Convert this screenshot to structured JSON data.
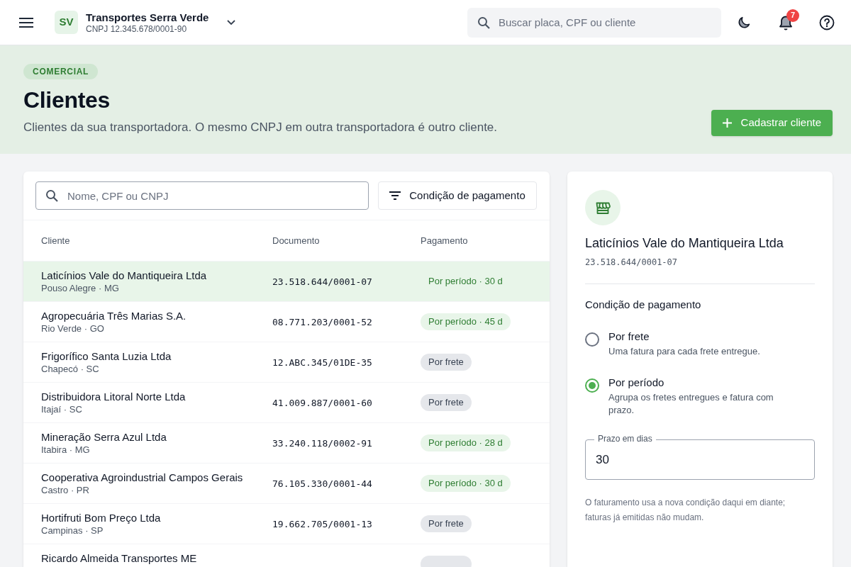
{
  "top_bar": {
    "company": {
      "initials": "SV",
      "name": "Transportes Serra Verde",
      "document": "CNPJ 12.345.678/0001-90"
    },
    "search": {
      "placeholder": "Buscar placa, CPF ou cliente"
    },
    "notifications": {
      "count": "7"
    }
  },
  "header": {
    "badge": "COMERCIAL",
    "title": "Clientes",
    "subtitle": "Clientes da sua transportadora. O mesmo CNPJ em outra transportadora é outro cliente.",
    "action": "Cadastrar cliente"
  },
  "clients": {
    "search": {
      "placeholder": "Nome, CPF ou CNPJ"
    },
    "filter": "Condição de pagamento",
    "table": {
      "columns": [
        "Cliente",
        "Documento",
        "Pagamento"
      ],
      "rows": [
        {
          "name": "Laticínios Vale do Mantiqueira Ltda",
          "location": "Pouso Alegre · MG",
          "document": "23.518.644/0001-07",
          "payment": {
            "kind": "periodo",
            "label": "Por período · 30 d"
          },
          "selected": true
        },
        {
          "name": "Agropecuária Três Marias S.A.",
          "location": "Rio Verde · GO",
          "document": "08.771.203/0001-52",
          "payment": {
            "kind": "periodo",
            "label": "Por período · 45 d"
          },
          "selected": false
        },
        {
          "name": "Frigorífico Santa Luzia Ltda",
          "location": "Chapecó · SC",
          "document": "12.ABC.345/01DE-35",
          "payment": {
            "kind": "frete",
            "label": "Por frete"
          },
          "selected": false
        },
        {
          "name": "Distribuidora Litoral Norte Ltda",
          "location": "Itajaí · SC",
          "document": "41.009.887/0001-60",
          "payment": {
            "kind": "frete",
            "label": "Por frete"
          },
          "selected": false
        },
        {
          "name": "Mineração Serra Azul Ltda",
          "location": "Itabira · MG",
          "document": "33.240.118/0002-91",
          "payment": {
            "kind": "periodo",
            "label": "Por período · 28 d"
          },
          "selected": false
        },
        {
          "name": "Cooperativa Agroindustrial Campos Gerais",
          "location": "Castro · PR",
          "document": "76.105.330/0001-44",
          "payment": {
            "kind": "periodo",
            "label": "Por período · 30 d"
          },
          "selected": false
        },
        {
          "name": "Hortifruti Bom Preço Ltda",
          "location": "Campinas · SP",
          "document": "19.662.705/0001-13",
          "payment": {
            "kind": "frete",
            "label": "Por frete"
          },
          "selected": false
        },
        {
          "name": "Ricardo Almeida Transportes ME",
          "payment": {
            "kind": "frete"
          },
          "selected": false
        }
      ]
    }
  },
  "detail": {
    "name": "Laticínios Vale do Mantiqueira Ltda",
    "document": "23.518.644/0001-07",
    "payment_condition": {
      "title": "Condição de pagamento",
      "options": [
        {
          "label": "Por frete",
          "description": "Uma fatura para cada frete entregue.",
          "selected": false
        },
        {
          "label": "Por período",
          "description": "Agrupa os fretes entregues e fatura com prazo.",
          "selected": true
        }
      ],
      "term_field": {
        "label": "Prazo em dias",
        "value": "30"
      },
      "note": "O faturamento usa a nova condição daqui em diante; faturas já emitidas não mudam."
    }
  }
}
